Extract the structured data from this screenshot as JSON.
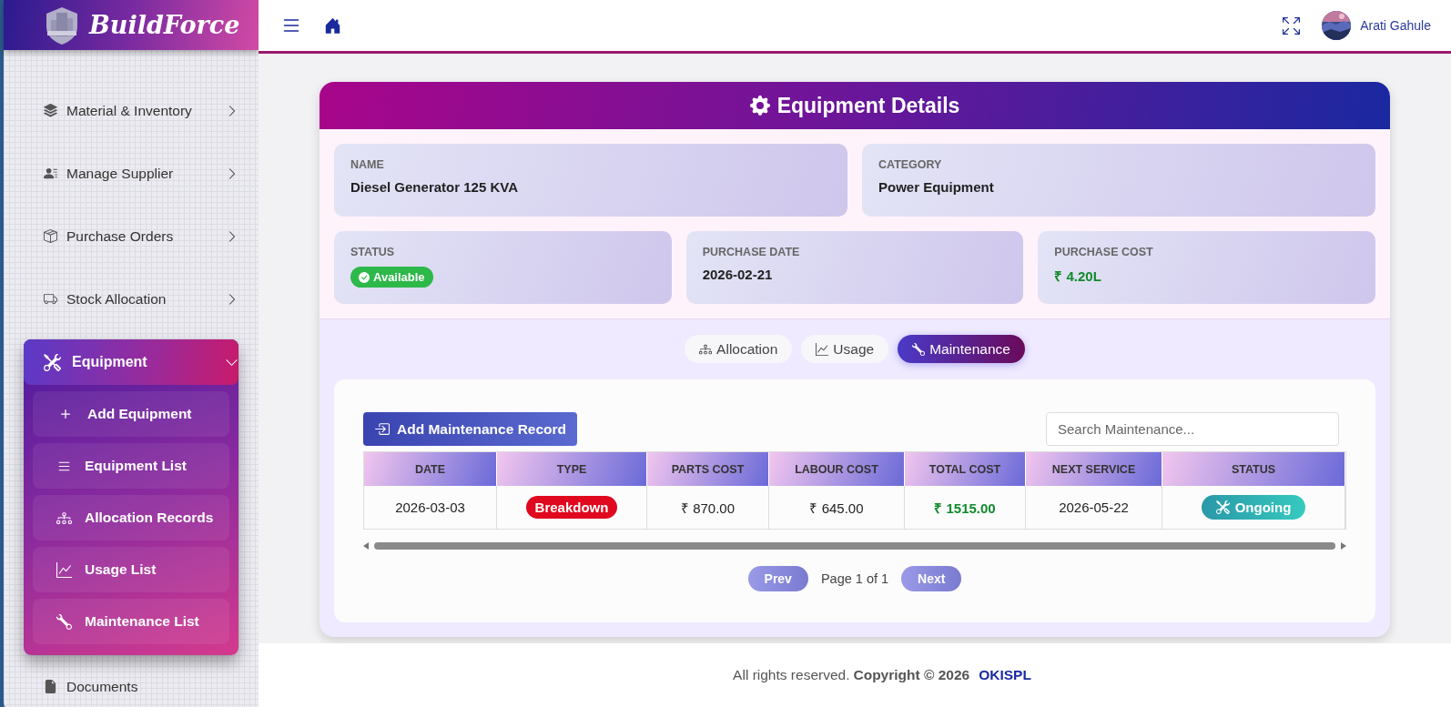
{
  "sidebar": {
    "logo": "BuildForce",
    "items": [
      {
        "label": "Material & Inventory",
        "expanded": false
      },
      {
        "label": "Manage Supplier",
        "expanded": false
      },
      {
        "label": "Purchase Orders",
        "expanded": false
      },
      {
        "label": "Stock Allocation",
        "expanded": false
      },
      {
        "label": "Equipment",
        "expanded": true,
        "children": [
          {
            "label": "Add Equipment"
          },
          {
            "label": "Equipment List"
          },
          {
            "label": "Allocation Records"
          },
          {
            "label": "Usage List"
          },
          {
            "label": "Maintenance List"
          }
        ]
      },
      {
        "label": "Documents"
      }
    ]
  },
  "topbar": {
    "user": "Arati Gahule"
  },
  "card": {
    "title": "Equipment Details",
    "fields": [
      {
        "label": "NAME",
        "value": "Diesel Generator 125 KVA",
        "kind": "text"
      },
      {
        "label": "CATEGORY",
        "value": "Power Equipment",
        "kind": "text"
      },
      {
        "label": "STATUS",
        "value": "Available",
        "kind": "badge"
      },
      {
        "label": "PURCHASE DATE",
        "value": "2026-02-21",
        "kind": "text"
      },
      {
        "label": "PURCHASE COST",
        "value": "₹ 4.20L",
        "kind": "money"
      }
    ],
    "tabs": [
      {
        "label": "Allocation",
        "selected": false
      },
      {
        "label": "Usage",
        "selected": false
      },
      {
        "label": "Maintenance",
        "selected": true
      }
    ],
    "add_button": "Add Maintenance Record",
    "search": {
      "placeholder": "Search Maintenance..."
    },
    "table": {
      "columns": [
        "DATE",
        "TYPE",
        "PARTS COST",
        "LABOUR COST",
        "TOTAL COST",
        "NEXT SERVICE",
        "STATUS"
      ],
      "rows": [
        [
          "2026-03-03",
          "Breakdown",
          "₹ 870.00",
          "₹ 645.00",
          "₹ 1515.00",
          "2026-05-22",
          "Ongoing"
        ]
      ]
    },
    "pagination": {
      "prev": "Prev",
      "info": "Page 1 of 1",
      "next": "Next"
    }
  },
  "footer": {
    "text": "All rights reserved.",
    "copyright": "Copyright © 2026",
    "company": "OKISPL"
  }
}
